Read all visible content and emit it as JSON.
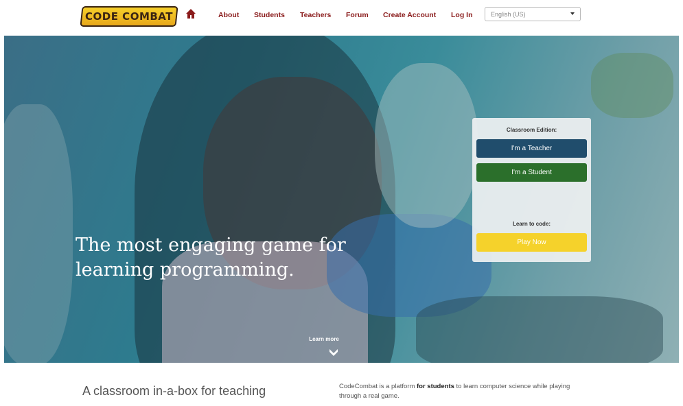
{
  "header": {
    "logo_text": "CODE COMBAT",
    "nav": [
      "About",
      "Students",
      "Teachers",
      "Forum",
      "Create Account",
      "Log In"
    ],
    "language": "English (US)"
  },
  "hero": {
    "headline_line1": "The most engaging game for",
    "headline_line2": "learning programming.",
    "learn_more": "Learn more"
  },
  "panel": {
    "title": "Classroom Edition:",
    "teacher_button": "I'm a Teacher",
    "student_button": "I'm a Student",
    "learn_title": "Learn to code:",
    "play_button": "Play Now"
  },
  "lower": {
    "tagline": "A classroom in-a-box for teaching",
    "desc_prefix": "CodeCombat is a platform ",
    "desc_bold": "for students",
    "desc_suffix": " to learn computer science while playing through a real game."
  },
  "colors": {
    "nav": "#8a1b1b",
    "teacher": "#204d6c",
    "student": "#2b6f2b",
    "play": "#f5d22b"
  }
}
